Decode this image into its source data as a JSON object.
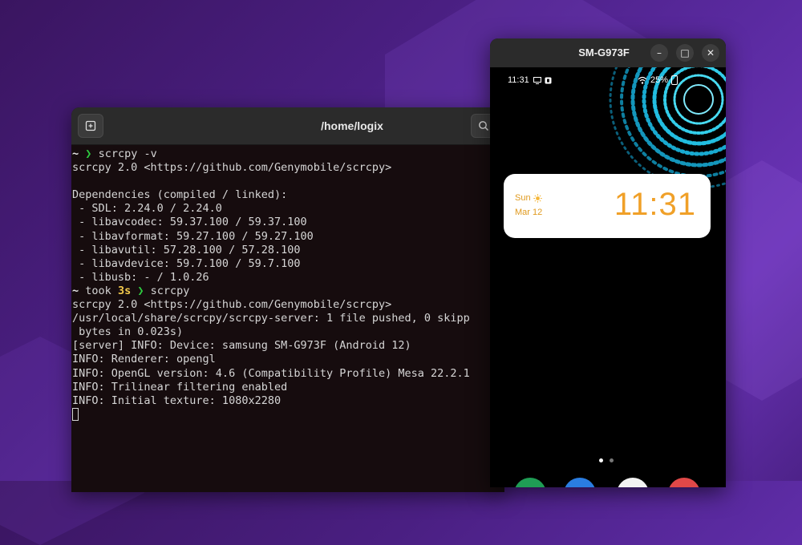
{
  "terminal": {
    "title": "/home/logix",
    "lines": [
      {
        "type": "prompt",
        "tilde": "~",
        "arrow": "❯",
        "cmd": "scrcpy -v"
      },
      {
        "type": "text",
        "text": "scrcpy 2.0 <https://github.com/Genymobile/scrcpy>"
      },
      {
        "type": "text",
        "text": ""
      },
      {
        "type": "text",
        "text": "Dependencies (compiled / linked):"
      },
      {
        "type": "text",
        "text": " - SDL: 2.24.0 / 2.24.0"
      },
      {
        "type": "text",
        "text": " - libavcodec: 59.37.100 / 59.37.100"
      },
      {
        "type": "text",
        "text": " - libavformat: 59.27.100 / 59.27.100"
      },
      {
        "type": "text",
        "text": " - libavutil: 57.28.100 / 57.28.100"
      },
      {
        "type": "text",
        "text": " - libavdevice: 59.7.100 / 59.7.100"
      },
      {
        "type": "text",
        "text": " - libusb: - / 1.0.26"
      },
      {
        "type": "took",
        "tilde": "~",
        "took": "took",
        "time": "3s",
        "arrow": "❯",
        "cmd": "scrcpy"
      },
      {
        "type": "text",
        "text": "scrcpy 2.0 <https://github.com/Genymobile/scrcpy>"
      },
      {
        "type": "text",
        "text": "/usr/local/share/scrcpy/scrcpy-server: 1 file pushed, 0 skipp"
      },
      {
        "type": "text",
        "text": " bytes in 0.023s)"
      },
      {
        "type": "text",
        "text": "[server] INFO: Device: samsung SM-G973F (Android 12)"
      },
      {
        "type": "text",
        "text": "INFO: Renderer: opengl"
      },
      {
        "type": "text",
        "text": "INFO: OpenGL version: 4.6 (Compatibility Profile) Mesa 22.2.1"
      },
      {
        "type": "text",
        "text": "INFO: Trilinear filtering enabled"
      },
      {
        "type": "text",
        "text": "INFO: Initial texture: 1080x2280"
      },
      {
        "type": "cursor"
      }
    ]
  },
  "phone_window": {
    "title": "SM-G973F",
    "minimize_label": "–",
    "maximize_label": "□",
    "close_label": "✕",
    "status": {
      "time": "11:31",
      "battery": "25%"
    },
    "clock_widget": {
      "day": "Sun",
      "date": "Mar 12",
      "time": "11:31"
    }
  },
  "colors": {
    "prompt_arrow": "#2ecc40",
    "took_time": "#f2c94c",
    "widget_accent": "#f0a028"
  }
}
